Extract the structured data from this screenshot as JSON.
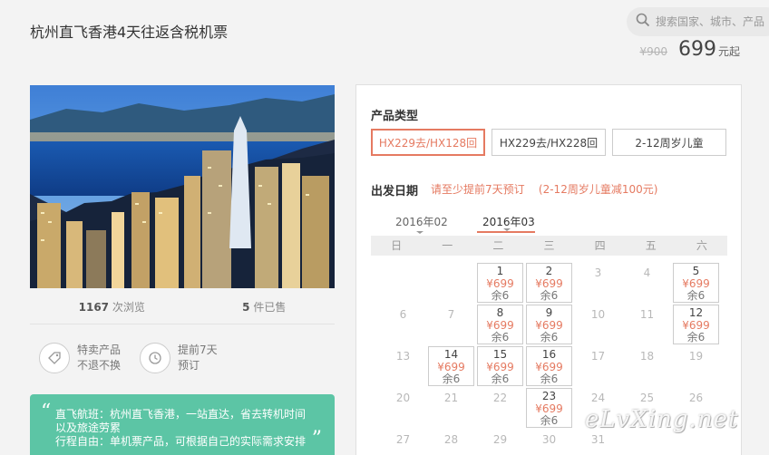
{
  "title": "杭州直飞香港4天往返含税机票",
  "search": {
    "placeholder": "搜索国家、城市、产品"
  },
  "price": {
    "original": "¥900",
    "current": "699",
    "unit": "元起"
  },
  "stats": {
    "views_count": "1167",
    "views_label": "次浏览",
    "sold_count": "5",
    "sold_label": "件已售"
  },
  "features": [
    {
      "line1": "特卖产品",
      "line2": "不退不换",
      "icon": "tag-icon"
    },
    {
      "line1": "提前7天",
      "line2": "预订",
      "icon": "clock-history-icon"
    }
  ],
  "notes_box": {
    "line1": "直飞航班：杭州直飞香港，一站直达，省去转机时间",
    "line2": "以及旅途劳累",
    "line3": "行程自由：单机票产品，可根据自己的实际需求安排"
  },
  "booking": {
    "product_type_label": "产品类型",
    "options": [
      "HX229去/HX128回",
      "HX229去/HX228回",
      "2-12周岁儿童"
    ],
    "selected_option": 0,
    "date_label": "出发日期",
    "advance_note": "请至少提前7天预订",
    "child_note": "(2-12周岁儿童减100元)",
    "months": [
      "2016年02",
      "2016年03"
    ],
    "active_month": 1,
    "weekdays": [
      "日",
      "一",
      "二",
      "三",
      "四",
      "五",
      "六"
    ],
    "weeks": [
      [
        null,
        null,
        {
          "d": "1",
          "p": "¥699",
          "r": "余6"
        },
        {
          "d": "2",
          "p": "¥699",
          "r": "余6"
        },
        {
          "d": "3"
        },
        {
          "d": "4"
        },
        {
          "d": "5",
          "p": "¥699",
          "r": "余6"
        }
      ],
      [
        {
          "d": "6"
        },
        {
          "d": "7"
        },
        {
          "d": "8",
          "p": "¥699",
          "r": "余6"
        },
        {
          "d": "9",
          "p": "¥699",
          "r": "余6"
        },
        {
          "d": "10"
        },
        {
          "d": "11"
        },
        {
          "d": "12",
          "p": "¥699",
          "r": "余6"
        }
      ],
      [
        {
          "d": "13"
        },
        {
          "d": "14",
          "p": "¥699",
          "r": "余6"
        },
        {
          "d": "15",
          "p": "¥699",
          "r": "余6"
        },
        {
          "d": "16",
          "p": "¥699",
          "r": "余6"
        },
        {
          "d": "17"
        },
        {
          "d": "18"
        },
        {
          "d": "19"
        }
      ],
      [
        {
          "d": "20"
        },
        {
          "d": "21"
        },
        {
          "d": "22"
        },
        {
          "d": "23",
          "p": "¥699",
          "r": "余6"
        },
        {
          "d": "24"
        },
        {
          "d": "25"
        },
        {
          "d": "26"
        }
      ],
      [
        {
          "d": "27"
        },
        {
          "d": "28"
        },
        {
          "d": "29"
        },
        {
          "d": "30"
        },
        {
          "d": "31"
        },
        null,
        null
      ]
    ]
  },
  "watermark": "eLvXing.net",
  "colors": {
    "accent": "#e57a61",
    "green": "#5cc5a5",
    "panel_bg": "#ffffff",
    "page_bg": "#f3f3f3"
  }
}
